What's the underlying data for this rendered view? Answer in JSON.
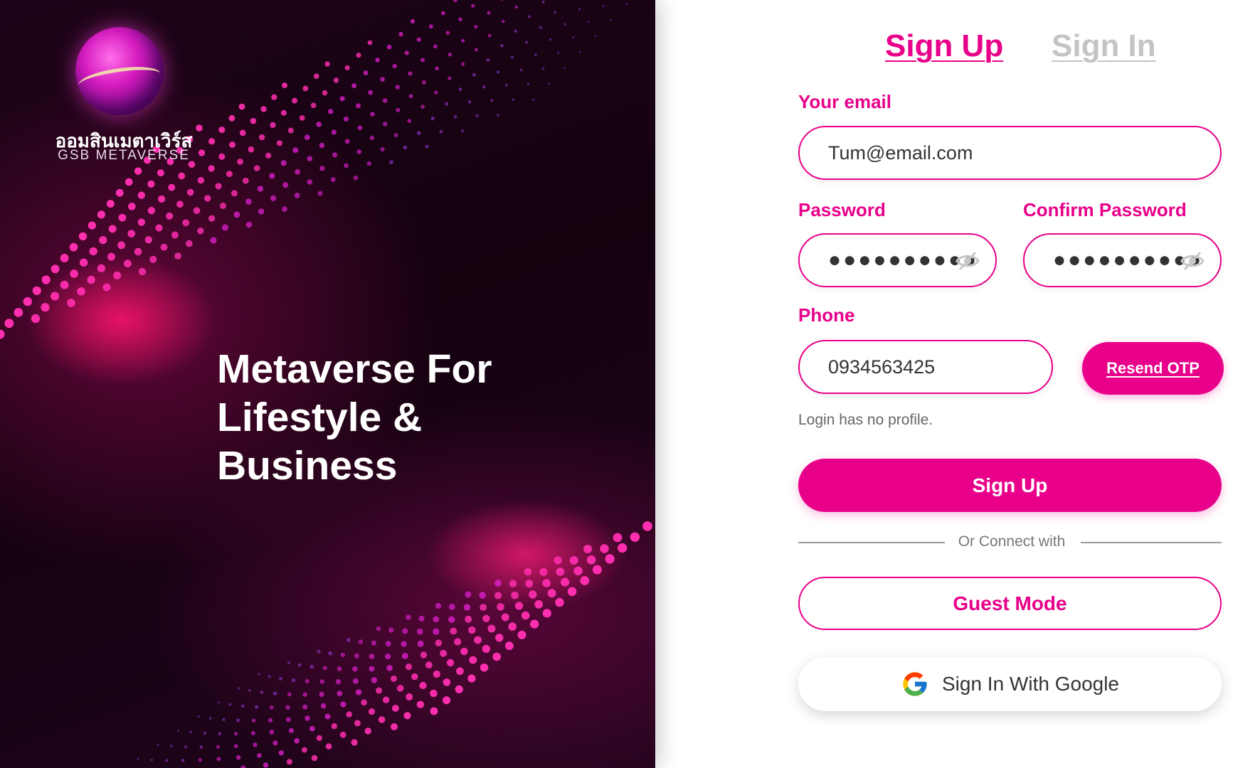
{
  "hero": {
    "logo_thai": "ออมสินเมตาเวิร์ส",
    "logo_en": "GSB METAVERSE",
    "headline_lines": [
      "Metaverse For",
      "Lifestyle &",
      "Business"
    ]
  },
  "tabs": {
    "sign_up": "Sign Up",
    "sign_in": "Sign In",
    "active": "sign_up"
  },
  "form": {
    "email_label": "Your email",
    "email_value": "Tum@email.com",
    "password_label": "Password",
    "password_mask": "●●●●●●●●●●",
    "confirm_label": "Confirm Password",
    "confirm_mask": "●●●●●●●●●●",
    "phone_label": "Phone",
    "phone_value": "0934563425",
    "resend_otp": "Resend OTP",
    "note": "Login has no profile.",
    "submit": "Sign Up",
    "divider": "Or Connect with",
    "guest": "Guest Mode",
    "google": "Sign In With Google"
  },
  "colors": {
    "accent": "#e8008a",
    "hero_bg": "#14020f",
    "inactive_tab": "#c4c4c4"
  },
  "icons": {
    "eye_hidden": "eye-off-icon",
    "google": "google-g-icon"
  }
}
